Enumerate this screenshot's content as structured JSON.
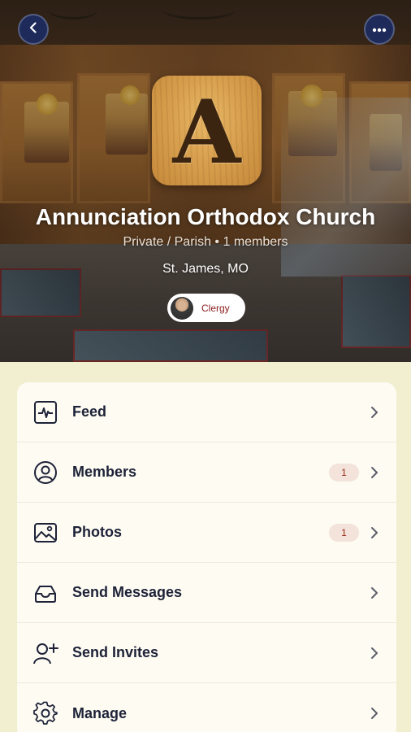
{
  "colors": {
    "nav_button_bg": "#1d2a5a",
    "card_bg": "#fdfbf2",
    "page_bg": "#f1efcf",
    "text_dark": "#1d2238",
    "badge_bg": "#f3e3da",
    "badge_text": "#9a2a1a",
    "clergy_text": "#8a1b1b"
  },
  "header": {
    "back_icon": "chevron-left-icon",
    "more_icon": "ellipsis-horizontal-icon",
    "logo_letter": "A"
  },
  "group": {
    "name": "Annunciation Orthodox Church",
    "meta": "Private / Parish • 1 members",
    "location": "St. James, MO",
    "role_chip": "Clergy"
  },
  "menu": [
    {
      "label": "Feed",
      "icon": "activity-feed-icon",
      "badge": ""
    },
    {
      "label": "Members",
      "icon": "user-circle-icon",
      "badge": "1"
    },
    {
      "label": "Photos",
      "icon": "image-icon",
      "badge": "1"
    },
    {
      "label": "Send Messages",
      "icon": "inbox-tray-icon",
      "badge": ""
    },
    {
      "label": "Send Invites",
      "icon": "user-add-icon",
      "badge": ""
    },
    {
      "label": "Manage",
      "icon": "gear-icon",
      "badge": ""
    }
  ]
}
